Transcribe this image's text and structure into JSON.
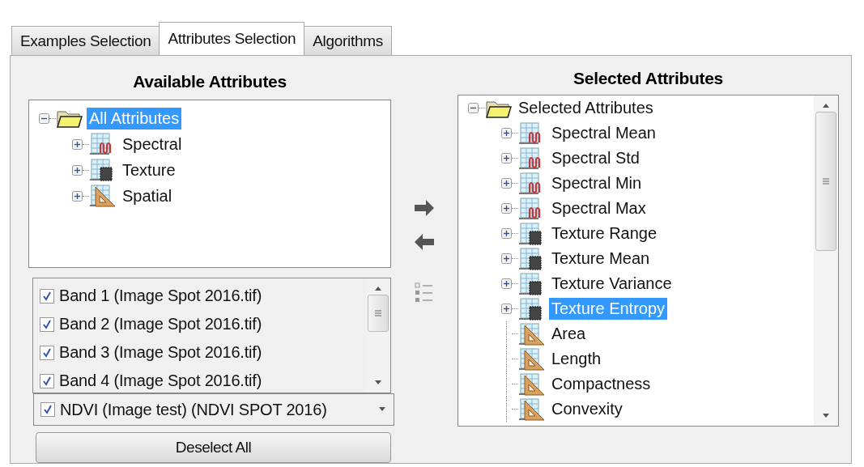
{
  "tabs": [
    {
      "label": "Examples Selection",
      "selected": false
    },
    {
      "label": "Attributes Selection",
      "selected": true
    },
    {
      "label": "Algorithms",
      "selected": false
    }
  ],
  "available": {
    "heading": "Available Attributes",
    "tree": [
      {
        "label": "All Attributes",
        "kind": "folder",
        "expanded": true,
        "selected": true,
        "children": [
          {
            "label": "Spectral",
            "kind": "spectral",
            "expanded": false,
            "selected": false
          },
          {
            "label": "Texture",
            "kind": "texture",
            "expanded": false,
            "selected": false
          },
          {
            "label": "Spatial",
            "kind": "spatial",
            "expanded": false,
            "selected": false
          }
        ]
      }
    ]
  },
  "bands": [
    {
      "label": "Band 1 (Image Spot 2016.tif)",
      "checked": true
    },
    {
      "label": "Band 2 (Image Spot 2016.tif)",
      "checked": true
    },
    {
      "label": "Band 3 (Image Spot 2016.tif)",
      "checked": true
    },
    {
      "label": "Band 4 (Image Spot 2016.tif)",
      "checked": true
    }
  ],
  "index_combo": {
    "label": "NDVI (Image test) (NDVI SPOT 2016)",
    "checked": true
  },
  "deselect_button": "Deselect All",
  "selected": {
    "heading": "Selected Attributes",
    "tree": [
      {
        "label": "Selected Attributes",
        "kind": "folder",
        "expanded": true,
        "selected": false,
        "children": [
          {
            "label": "Spectral Mean",
            "kind": "spectral",
            "expanded": false,
            "selected": false
          },
          {
            "label": "Spectral Std",
            "kind": "spectral",
            "expanded": false,
            "selected": false
          },
          {
            "label": "Spectral Min",
            "kind": "spectral",
            "expanded": false,
            "selected": false
          },
          {
            "label": "Spectral Max",
            "kind": "spectral",
            "expanded": false,
            "selected": false
          },
          {
            "label": "Texture Range",
            "kind": "texture",
            "expanded": false,
            "selected": false
          },
          {
            "label": "Texture Mean",
            "kind": "texture",
            "expanded": false,
            "selected": false
          },
          {
            "label": "Texture Variance",
            "kind": "texture",
            "expanded": false,
            "selected": false
          },
          {
            "label": "Texture Entropy",
            "kind": "texture",
            "expanded": false,
            "selected": true
          },
          {
            "label": "Area",
            "kind": "spatial",
            "selected": false
          },
          {
            "label": "Length",
            "kind": "spatial",
            "selected": false
          },
          {
            "label": "Compactness",
            "kind": "spatial",
            "selected": false
          },
          {
            "label": "Convexity",
            "kind": "spatial",
            "selected": false
          }
        ]
      }
    ]
  }
}
